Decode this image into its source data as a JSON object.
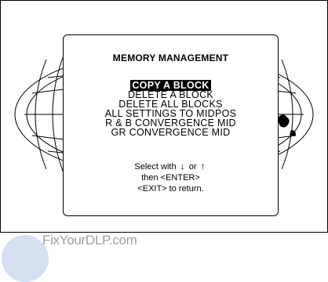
{
  "menu": {
    "title": "MEMORY MANAGEMENT",
    "items": [
      {
        "label": "COPY A BLOCK",
        "selected": true
      },
      {
        "label": "DELETE  A  BLOCK",
        "selected": false
      },
      {
        "label": "DELETE  ALL  BLOCKS",
        "selected": false
      },
      {
        "label": "ALL  SETTINGS  TO  MIDPOS",
        "selected": false
      },
      {
        "label": "R & B  CONVERGENCE  MID",
        "selected": false
      },
      {
        "label": "GR  CONVERGENCE  MID",
        "selected": false
      }
    ],
    "instructions": {
      "select_prefix": "Select with",
      "or_text": "or",
      "then_text": "then <ENTER>",
      "exit_text": "<EXIT>  to  return."
    }
  },
  "icons": {
    "down_arrow": "down-arrow-icon",
    "up_arrow": "up-arrow-icon"
  },
  "watermark": {
    "text": "FixYourDLP.com"
  },
  "colors": {
    "background": "#ffffff",
    "foreground": "#000000",
    "selection_bg": "#000000",
    "selection_fg": "#ffffff",
    "watermark": "#9e9e9e"
  }
}
